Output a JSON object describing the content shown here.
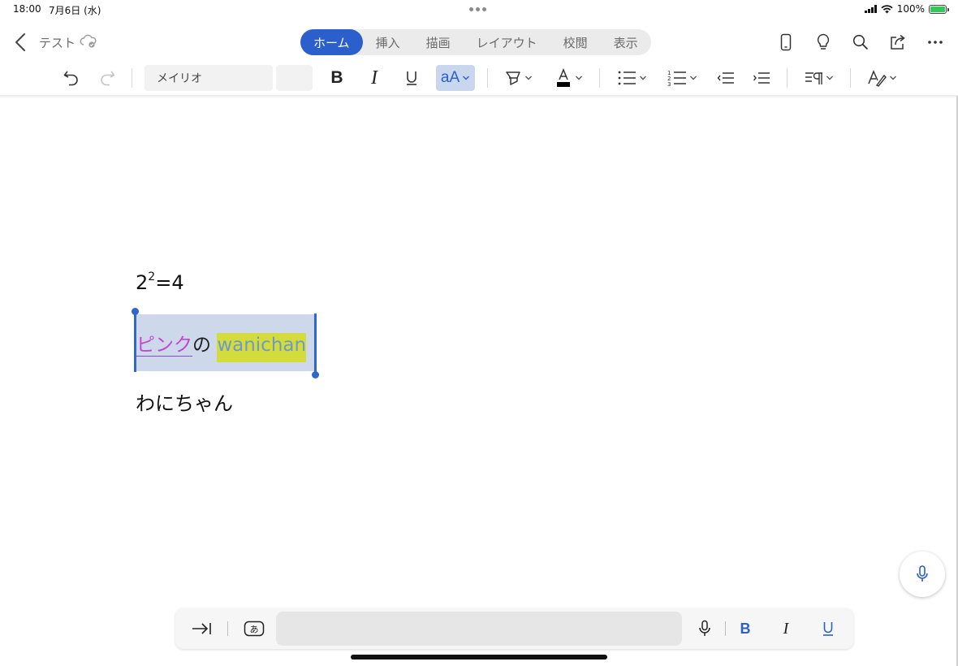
{
  "status": {
    "time": "18:00",
    "date": "7月6日 (水)",
    "battery": "100%"
  },
  "title": {
    "doc_name": "テスト"
  },
  "tabs": [
    {
      "label": "ホーム",
      "active": true
    },
    {
      "label": "挿入"
    },
    {
      "label": "描画"
    },
    {
      "label": "レイアウト"
    },
    {
      "label": "校閲"
    },
    {
      "label": "表示"
    }
  ],
  "ribbon": {
    "font_name": "メイリオ",
    "font_size": ""
  },
  "document": {
    "para1": {
      "base": "2",
      "exponent": "2",
      "rest": "=4"
    },
    "para2": {
      "pink": "ピンク",
      "mid": "の",
      "highlight": "wanichan"
    },
    "para3": "わにちゃん"
  },
  "colors": {
    "accent": "#2b5fcc",
    "selection": "#cdd9ea",
    "pink_text": "#c445cf",
    "highlight": "#d4dc3c",
    "highlight_text": "#6f9ac6"
  },
  "icons": [
    "back-icon",
    "cloud-sync-icon",
    "phone-icon",
    "lightbulb-icon",
    "search-icon",
    "share-icon",
    "more-icon",
    "undo-icon",
    "redo-icon",
    "bold-icon",
    "italic-icon",
    "underline-icon",
    "text-effects-icon",
    "highlighter-icon",
    "font-color-icon",
    "bullets-icon",
    "numbering-icon",
    "decrease-indent-icon",
    "increase-indent-icon",
    "paragraph-icon",
    "styles-icon",
    "microphone-icon",
    "tab-icon",
    "keyboard-kana-icon"
  ]
}
